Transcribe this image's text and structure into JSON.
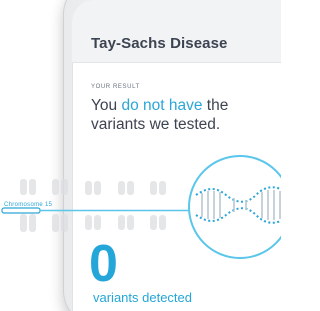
{
  "screen": {
    "title": "Tay-Sachs Disease",
    "result_label": "YOUR RESULT",
    "result_prefix": "You ",
    "result_highlight": "do not have",
    "result_suffix": "the variants we tested.",
    "variant_count": "0",
    "variant_label": "variants detected"
  },
  "illustration": {
    "chromosome_label": "Chromosome 15",
    "chromosome_color": "#d7d9dc",
    "highlight_color": "#2ca6d8",
    "magnifier_icon": "dna-icon"
  }
}
